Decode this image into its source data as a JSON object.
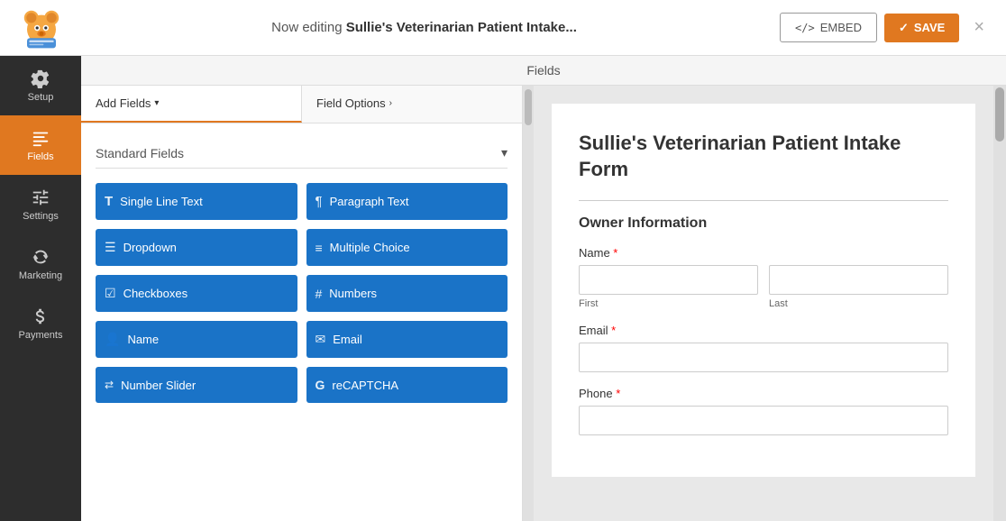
{
  "header": {
    "editing_prefix": "Now editing ",
    "form_name": "Sullie's Veterinarian Patient Intake...",
    "embed_label": "EMBED",
    "save_label": "SAVE",
    "close_label": "×"
  },
  "sidebar": {
    "items": [
      {
        "id": "setup",
        "label": "Setup",
        "active": false
      },
      {
        "id": "fields",
        "label": "Fields",
        "active": true
      },
      {
        "id": "settings",
        "label": "Settings",
        "active": false
      },
      {
        "id": "marketing",
        "label": "Marketing",
        "active": false
      },
      {
        "id": "payments",
        "label": "Payments",
        "active": false
      }
    ]
  },
  "fields_header": {
    "label": "Fields"
  },
  "left_panel": {
    "tabs": [
      {
        "id": "add-fields",
        "label": "Add Fields",
        "active": true
      },
      {
        "id": "field-options",
        "label": "Field Options",
        "active": false
      }
    ],
    "standard_fields_label": "Standard Fields",
    "field_buttons": [
      {
        "id": "single-line-text",
        "label": "Single Line Text",
        "icon": "T"
      },
      {
        "id": "paragraph-text",
        "label": "Paragraph Text",
        "icon": "¶"
      },
      {
        "id": "dropdown",
        "label": "Dropdown",
        "icon": "☰"
      },
      {
        "id": "multiple-choice",
        "label": "Multiple Choice",
        "icon": "≡"
      },
      {
        "id": "checkboxes",
        "label": "Checkboxes",
        "icon": "☑"
      },
      {
        "id": "numbers",
        "label": "Numbers",
        "icon": "#"
      },
      {
        "id": "name",
        "label": "Name",
        "icon": "👤"
      },
      {
        "id": "email",
        "label": "Email",
        "icon": "✉"
      },
      {
        "id": "number-slider",
        "label": "Number Slider",
        "icon": "⇄"
      },
      {
        "id": "recaptcha",
        "label": "reCAPTCHA",
        "icon": "G"
      }
    ]
  },
  "form_preview": {
    "title": "Sullie's Veterinarian Patient Intake Form",
    "section_owner": "Owner Information",
    "fields": [
      {
        "id": "name",
        "label": "Name",
        "required": true,
        "type": "name",
        "sub_labels": [
          "First",
          "Last"
        ]
      },
      {
        "id": "email",
        "label": "Email",
        "required": true,
        "type": "text"
      },
      {
        "id": "phone",
        "label": "Phone",
        "required": true,
        "type": "text"
      }
    ]
  },
  "colors": {
    "active_sidebar": "#e07820",
    "field_btn_bg": "#1a73c7",
    "dark_sidebar": "#2d2d2d"
  }
}
